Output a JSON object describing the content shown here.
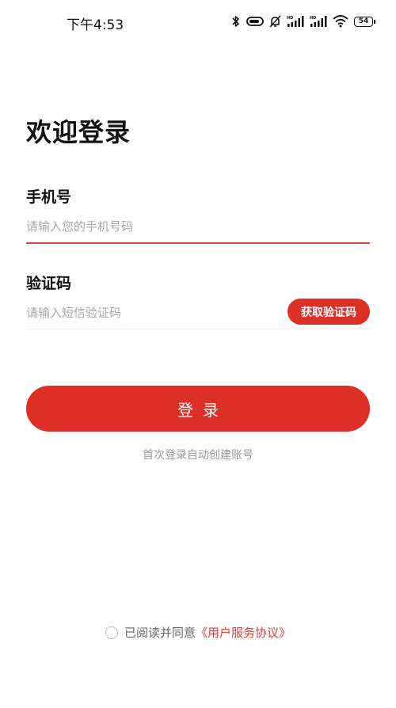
{
  "status_bar": {
    "time": "下午4:53",
    "battery": "54",
    "icons": [
      "bluetooth-icon",
      "vpn-icon",
      "mute-icon",
      "hd-signal-icon",
      "hd-signal-icon",
      "wifi-icon",
      "battery-icon"
    ]
  },
  "page": {
    "title": "欢迎登录"
  },
  "phone": {
    "label": "手机号",
    "placeholder": "请输入您的手机号码",
    "value": ""
  },
  "code": {
    "label": "验证码",
    "placeholder": "请输入短信验证码",
    "value": "",
    "get_code_label": "获取验证码"
  },
  "login": {
    "button_label": "登录",
    "hint": "首次登录自动创建账号"
  },
  "agreement": {
    "text": "已阅读并同意",
    "link": "《用户服务协议》",
    "checked": false
  },
  "colors": {
    "accent": "#dc2f25",
    "active_underline": "#d9413a"
  }
}
